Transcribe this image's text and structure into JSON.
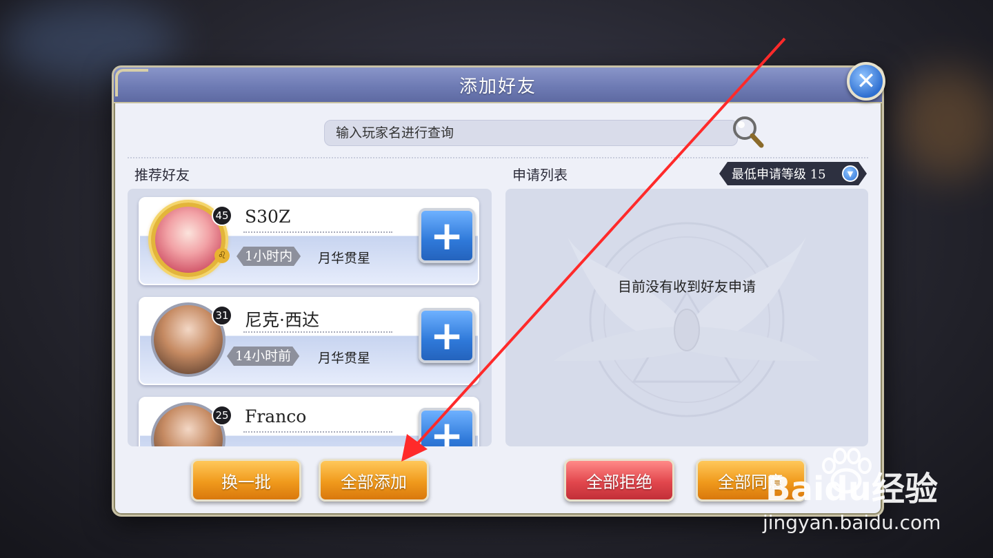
{
  "dialog": {
    "title": "添加好友",
    "close_icon": "close-icon",
    "search": {
      "placeholder": "输入玩家名进行查询",
      "value": "",
      "icon": "magnifier-icon"
    }
  },
  "recommend": {
    "label": "推荐好友",
    "players": [
      {
        "name": "S30Z",
        "level": "45",
        "last_online": "1小时内",
        "server": "月华贯星",
        "frame": "gold"
      },
      {
        "name": "尼克·西达",
        "level": "31",
        "last_online": "14小时前",
        "server": "月华贯星",
        "frame": "silver"
      },
      {
        "name": "Franco",
        "level": "25",
        "last_online": "",
        "server": "",
        "frame": "silver"
      }
    ],
    "add_icon": "plus-icon"
  },
  "apply": {
    "label": "申请列表",
    "empty_text": "目前没有收到好友申请",
    "min_level_label": "最低申请等级 15",
    "dropdown_icon": "chevron-down-icon"
  },
  "buttons": {
    "refresh": "换一批",
    "add_all": "全部添加",
    "reject_all": "全部拒绝",
    "accept_all": "全部同意"
  },
  "watermark": {
    "brand": "Baidu经验",
    "url": "jingyan.baidu.com"
  },
  "colors": {
    "title_bar": "#6e7bb4",
    "add_button": "#2f79d9",
    "orange_button": "#f09a1c",
    "red_button": "#e2474d",
    "arrow": "#ff2a2a"
  }
}
